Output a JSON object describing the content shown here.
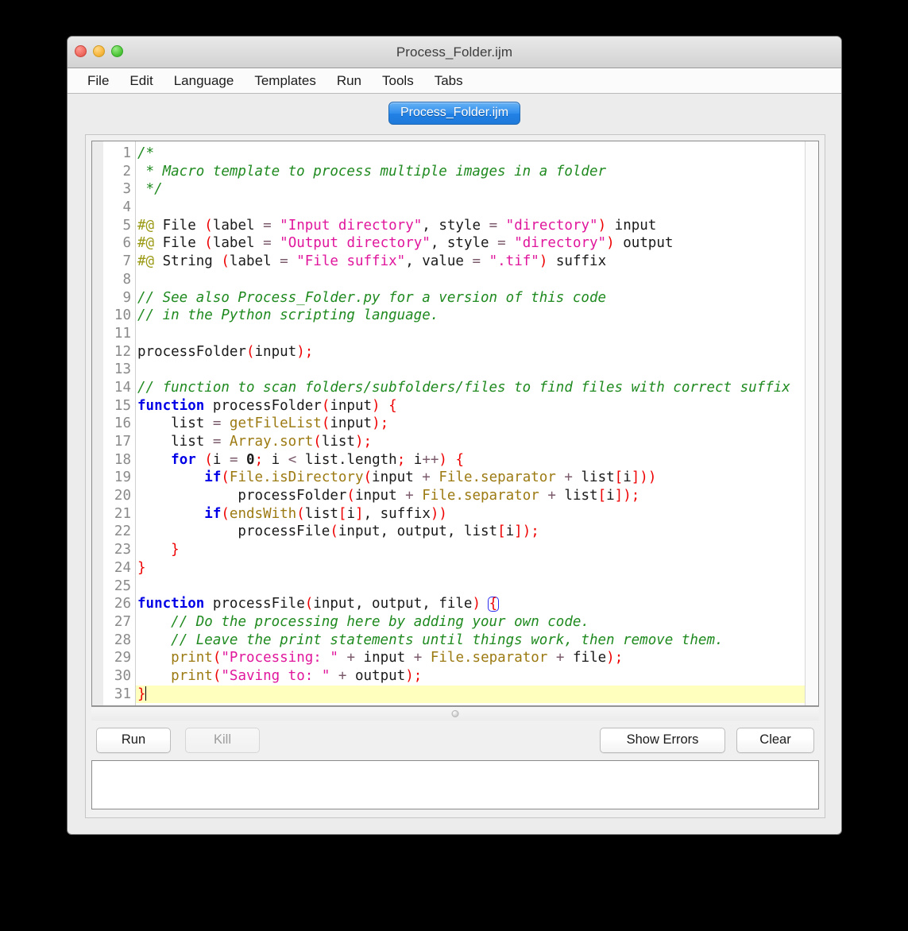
{
  "window": {
    "title": "Process_Folder.ijm",
    "traffic_lights": [
      "close-button",
      "minimize-button",
      "maximize-button"
    ]
  },
  "menubar": {
    "items": [
      "File",
      "Edit",
      "Language",
      "Templates",
      "Run",
      "Tools",
      "Tabs"
    ]
  },
  "tabs": {
    "active": "Process_Folder.ijm",
    "items": [
      "Process_Folder.ijm"
    ]
  },
  "editor": {
    "language": "ImageJ Macro",
    "current_line": 31,
    "line_count": 31,
    "caret_line": 31,
    "line_numbers": [
      "1",
      "2",
      "3",
      "4",
      "5",
      "6",
      "7",
      "8",
      "9",
      "10",
      "11",
      "12",
      "13",
      "14",
      "15",
      "16",
      "17",
      "18",
      "19",
      "20",
      "21",
      "22",
      "23",
      "24",
      "25",
      "26",
      "27",
      "28",
      "29",
      "30",
      "31"
    ],
    "plain_text": [
      "/*",
      " * Macro template to process multiple images in a folder",
      " */",
      "",
      "#@ File (label = \"Input directory\", style = \"directory\") input",
      "#@ File (label = \"Output directory\", style = \"directory\") output",
      "#@ String (label = \"File suffix\", value = \".tif\") suffix",
      "",
      "// See also Process_Folder.py for a version of this code",
      "// in the Python scripting language.",
      "",
      "processFolder(input);",
      "",
      "// function to scan folders/subfolders/files to find files with correct suffix",
      "function processFolder(input) {",
      "    list = getFileList(input);",
      "    list = Array.sort(list);",
      "    for (i = 0; i < list.length; i++) {",
      "        if(File.isDirectory(input + File.separator + list[i]))",
      "            processFolder(input + File.separator + list[i]);",
      "        if(endsWith(list[i], suffix))",
      "            processFile(input, output, list[i]);",
      "    }",
      "}",
      "",
      "function processFile(input, output, file) {",
      "    // Do the processing here by adding your own code.",
      "    // Leave the print statements until things work, then remove them.",
      "    print(\"Processing: \" + input + File.separator + file);",
      "    print(\"Saving to: \" + output);",
      "}"
    ]
  },
  "toolbar": {
    "run_label": "Run",
    "kill_label": "Kill",
    "kill_enabled": false,
    "show_errors_label": "Show Errors",
    "clear_label": "Clear"
  },
  "console": {
    "text": ""
  },
  "colors": {
    "comment": "#1f8a1f",
    "keyword": "#0000e6",
    "string": "#e0179c",
    "punctuation": "#ee0000",
    "builtin": "#9c7a12",
    "directive": "#9a9a15",
    "operator": "#7b5a6b",
    "current_line_highlight": "#ffffbe",
    "tab_accent": "#2f8ded"
  }
}
